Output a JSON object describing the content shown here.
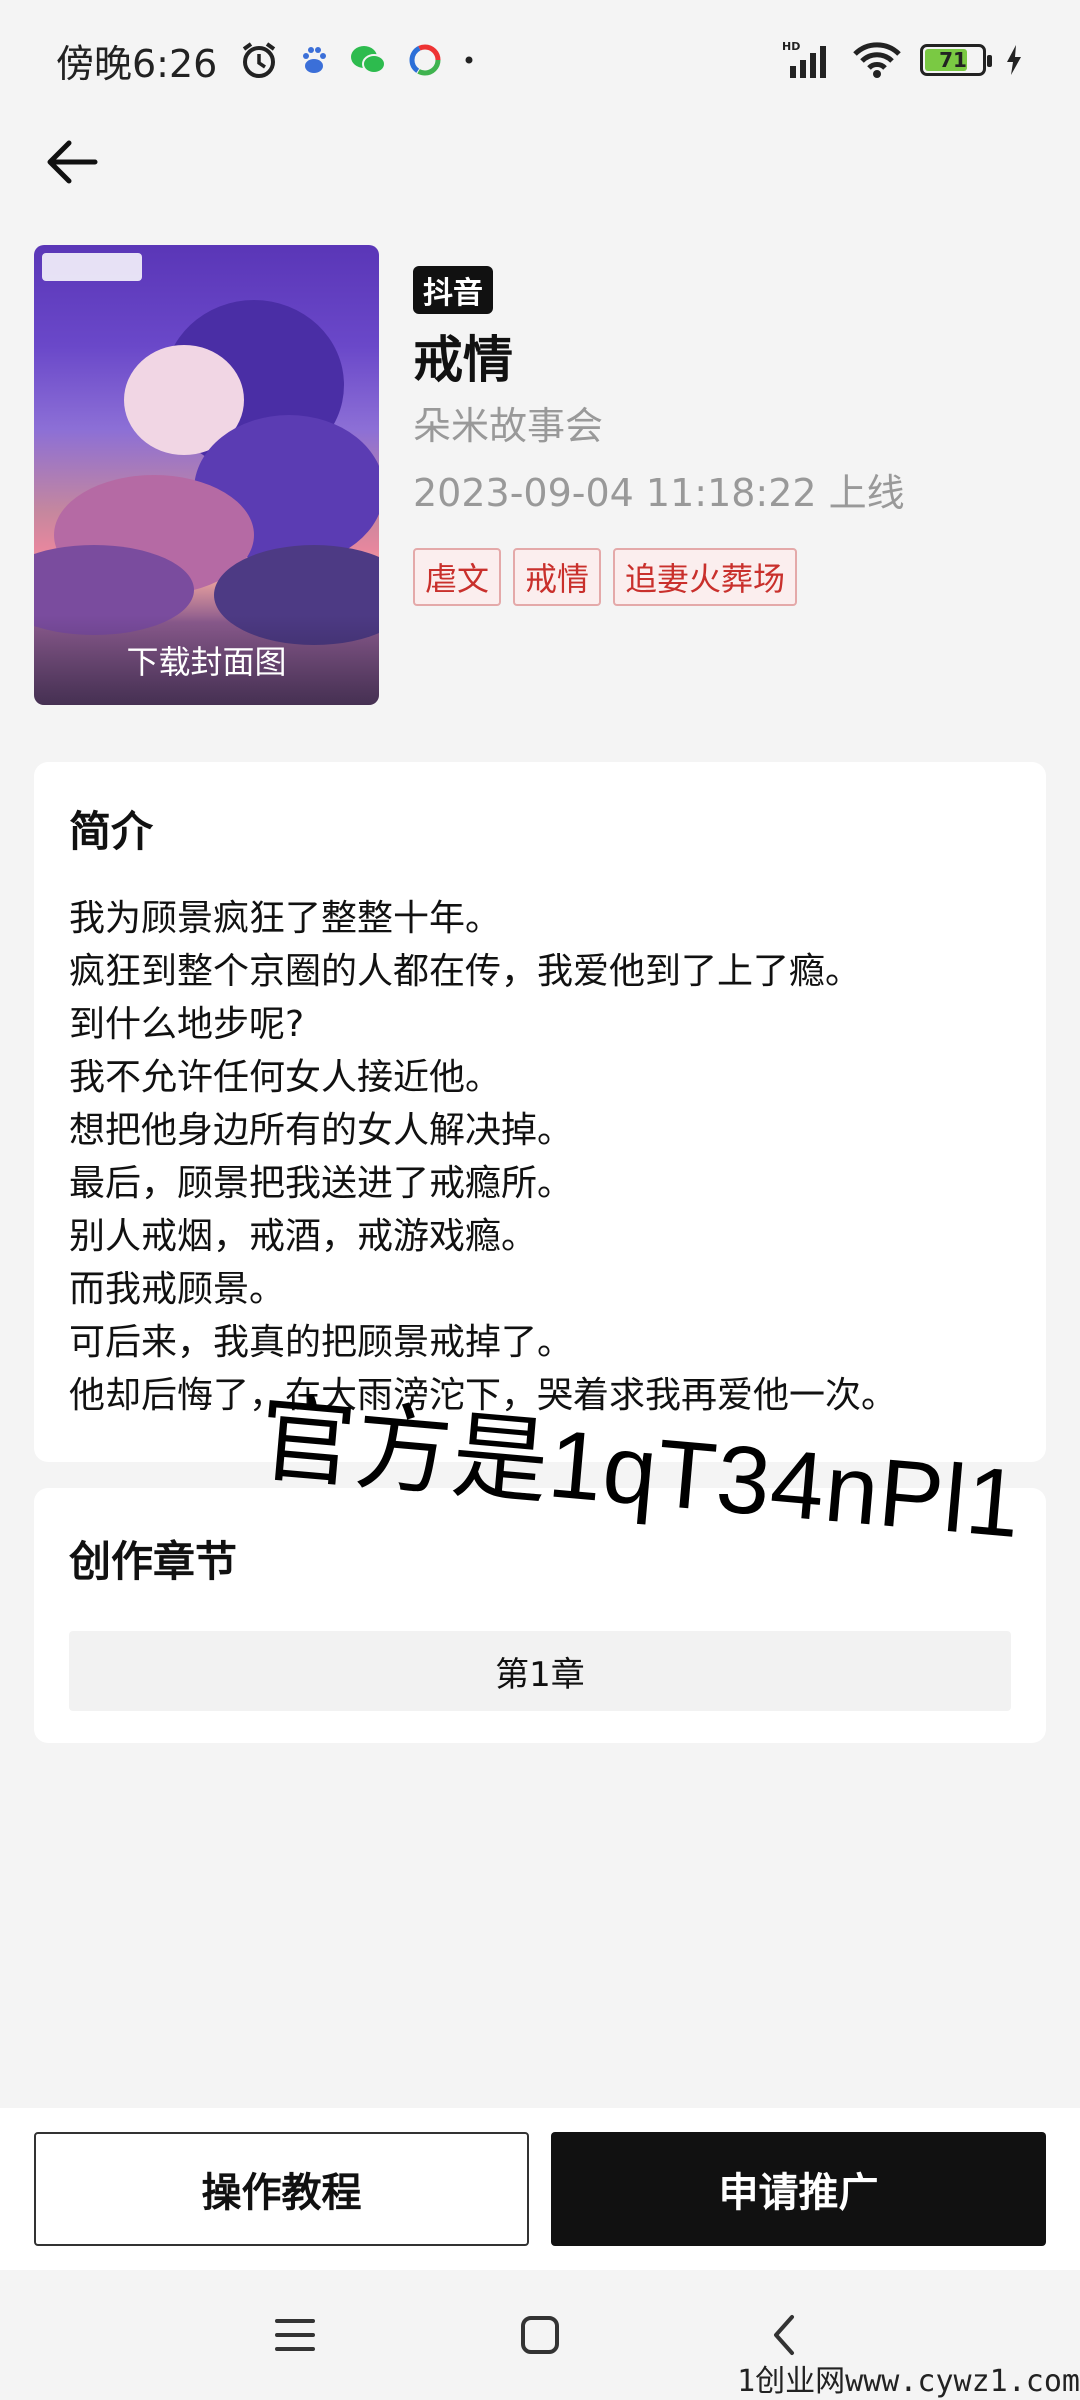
{
  "status_bar": {
    "time": "傍晚6:26",
    "battery": "71",
    "network": "HD"
  },
  "book": {
    "platform": "抖音",
    "title": "戒情",
    "author": "朵米故事会",
    "release": "2023-09-04 11:18:22 上线",
    "cover_action": "下载封面图",
    "tags": [
      "虐文",
      "戒情",
      "追妻火葬场"
    ]
  },
  "intro": {
    "heading": "简介",
    "lines": [
      "我为顾景疯狂了整整十年。",
      "疯狂到整个京圈的人都在传，我爱他到了上了瘾。",
      "到什么地步呢?",
      "我不允许任何女人接近他。",
      "想把他身边所有的女人解决掉。",
      "最后，顾景把我送进了戒瘾所。",
      "别人戒烟，戒酒，戒游戏瘾。",
      "而我戒顾景。",
      "可后来，我真的把顾景戒掉了。",
      "他却后悔了，在大雨滂沱下，哭着求我再爱他一次。"
    ]
  },
  "chapters": {
    "heading": "创作章节",
    "items": [
      "第1章"
    ]
  },
  "watermark": "官方是1qT34nPl1",
  "actions": {
    "tutorial": "操作教程",
    "promote": "申请推广"
  },
  "site_mark": "1创业网www.cywz1.com"
}
